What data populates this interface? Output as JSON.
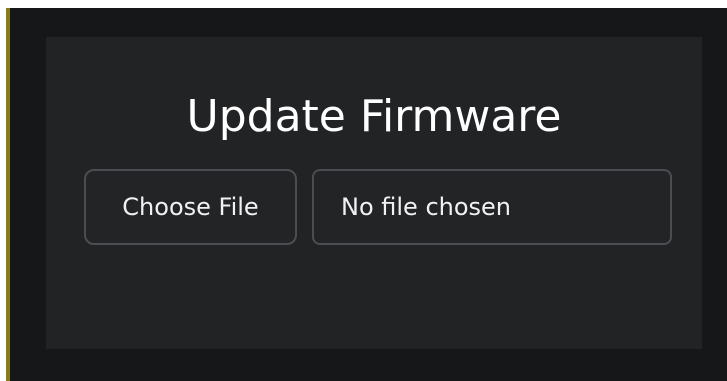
{
  "firmware_update": {
    "title": "Update Firmware",
    "file_input": {
      "button_label": "Choose File",
      "status_text": "No file chosen"
    }
  },
  "colors": {
    "background": "#151719",
    "panel": "#222325",
    "border": "#4a4d52",
    "text": "#ffffff"
  }
}
